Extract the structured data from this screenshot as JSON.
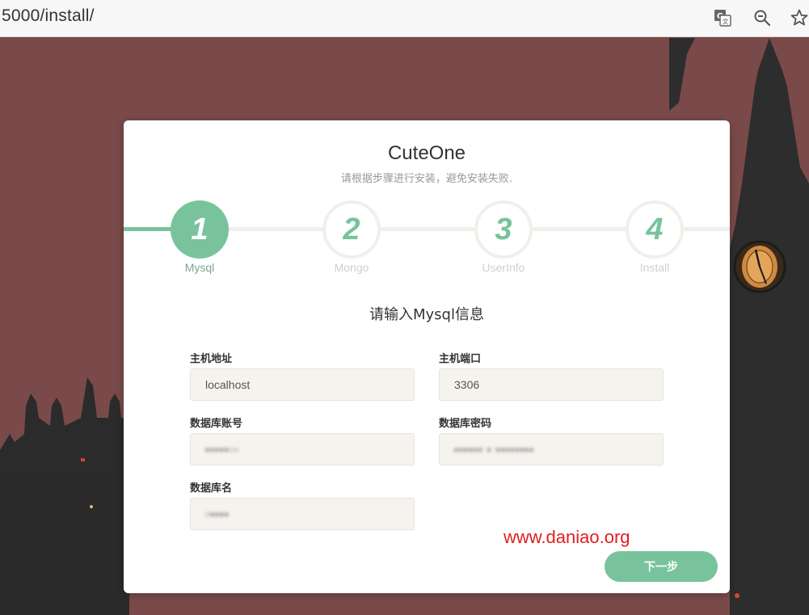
{
  "browser": {
    "url": "5000/install/",
    "icons": [
      "translate-icon",
      "zoom-icon",
      "bookmark-star-icon"
    ]
  },
  "card": {
    "title": "CuteOne",
    "subtitle": "请根据步骤进行安装，避免安装失败.",
    "steps": [
      {
        "number": "1",
        "label": "Mysql",
        "state": "active"
      },
      {
        "number": "2",
        "label": "Mongo",
        "state": "pending"
      },
      {
        "number": "3",
        "label": "UserInfo",
        "state": "pending"
      },
      {
        "number": "4",
        "label": "Install",
        "state": "pending"
      }
    ],
    "section_title": "请输入Mysql信息",
    "fields": {
      "host": {
        "label": "主机地址",
        "value": "localhost"
      },
      "port": {
        "label": "主机端口",
        "value": "3306"
      },
      "user": {
        "label": "数据库账号",
        "value": "blurred"
      },
      "password": {
        "label": "数据库密码",
        "value": "blurred"
      },
      "dbname": {
        "label": "数据库名",
        "value": "blurred"
      }
    },
    "next_button": "下一步"
  },
  "watermark": "www.daniao.org",
  "colors": {
    "accent": "#78c39c",
    "background_sky": "#7a4a4a",
    "watermark": "#e01e1e"
  }
}
